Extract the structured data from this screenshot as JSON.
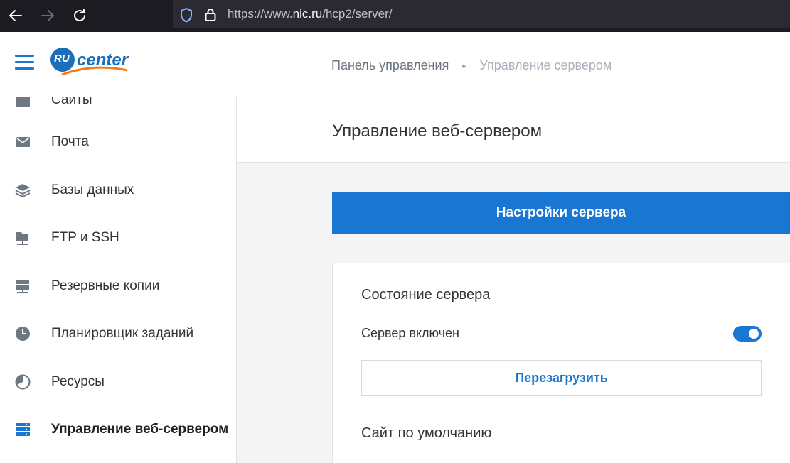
{
  "browser": {
    "url_prefix": "https://www.",
    "url_host": "nic.ru",
    "url_path": "/hcp2/server/"
  },
  "header": {
    "logo_badge": "RU",
    "logo_text": "center",
    "breadcrumb": [
      "Панель управления",
      "Управление сервером"
    ]
  },
  "sidebar": {
    "items": [
      {
        "label": "Сайты",
        "icon": "sites-icon"
      },
      {
        "label": "Почта",
        "icon": "mail-icon"
      },
      {
        "label": "Базы данных",
        "icon": "database-icon"
      },
      {
        "label": "FTP и SSH",
        "icon": "folder-icon"
      },
      {
        "label": "Резервные копии",
        "icon": "backup-icon"
      },
      {
        "label": "Планировщик заданий",
        "icon": "clock-icon"
      },
      {
        "label": "Ресурсы",
        "icon": "resources-icon"
      },
      {
        "label": "Управление веб-сервером",
        "icon": "server-icon",
        "active": true
      }
    ]
  },
  "main": {
    "title": "Управление веб-сервером",
    "settings_button": "Настройки сервера",
    "status_section_title": "Состояние сервера",
    "server_toggle_label": "Сервер включен",
    "server_enabled": true,
    "reload_button": "Перезагрузить",
    "default_site_title": "Сайт по умолчанию"
  },
  "colors": {
    "accent": "#1976d2",
    "browser_bg": "#1c1b22",
    "logo_orange": "#f47b20"
  }
}
